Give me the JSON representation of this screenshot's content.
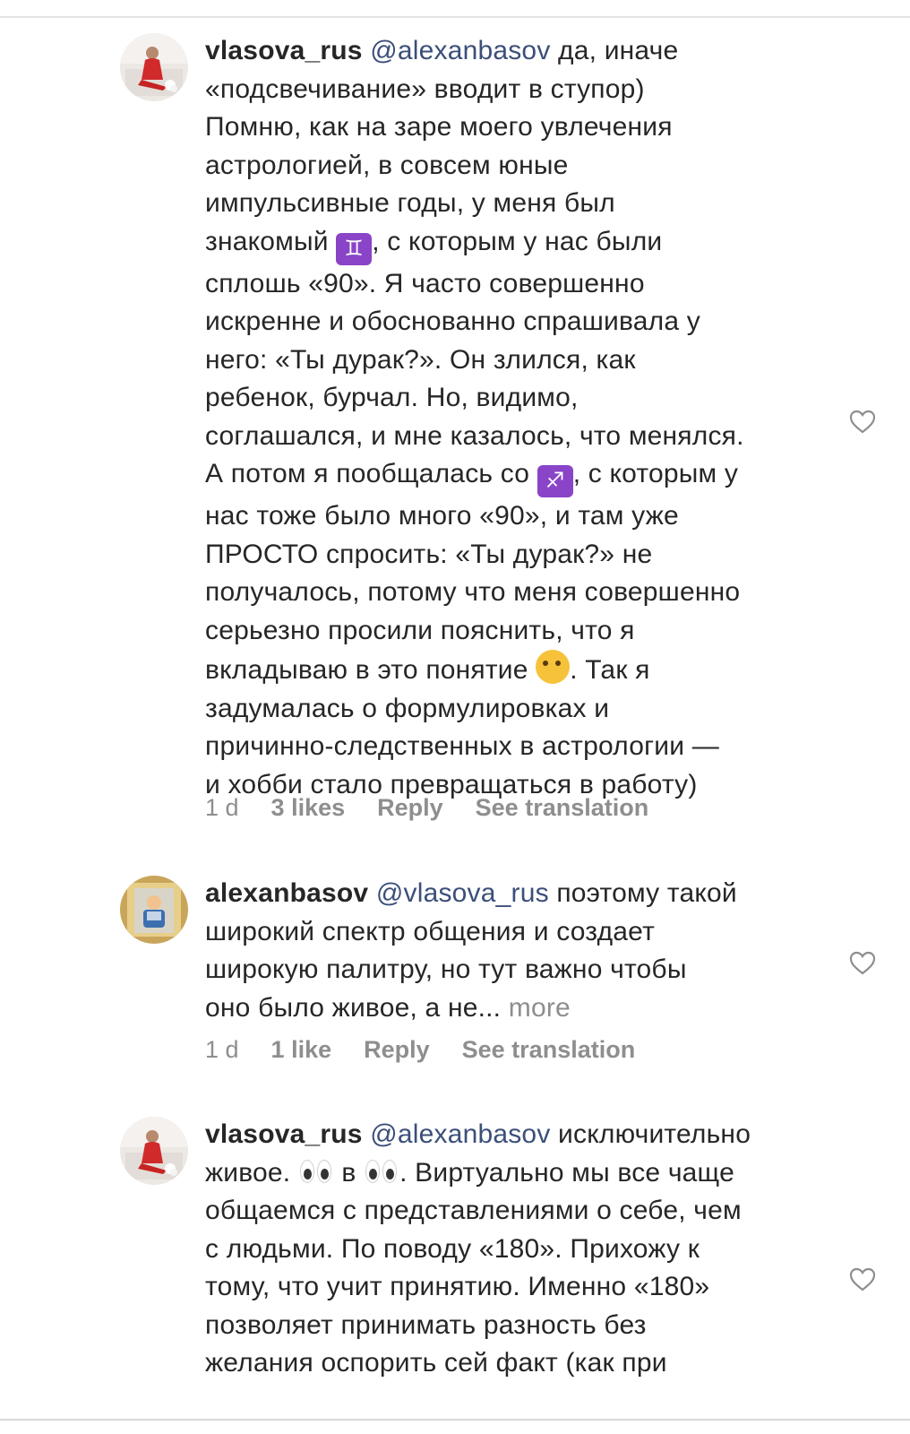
{
  "comments": [
    {
      "username": "vlasova_rus",
      "mention": "@alexanbasov",
      "text_1": " да, иначе\n«подсвечивание» вводит в ступор)\nПомню, как на заре моего увлечения\nастрологией, в совсем юные\nимпульсивные годы, у меня был\nзнакомый ",
      "text_2": ", с которым у нас были\nсплошь «90». Я часто совершенно\nискренне и обоснованно спрашивала у\nнего: «Ты дурак?». Он злился, как\nребенок, бурчал. Но, видимо,\nсоглашался, и мне казалось, что менялся.\nА потом я пообщалась со ",
      "text_3": ", с которым у\nнас тоже было много «90», и там уже\nПРОСТО спросить: «Ты дурак?» не\nполучалось, потому что меня совершенно\nсерьезно просили пояснить, что я\nвкладываю в это понятие ",
      "text_4": ". Так я\nзадумалась о формулировках и\nпричинно-следственных в астрологии —\nи хобби стало превращаться в работу)",
      "emoji_1": "♊",
      "emoji_2": "♐",
      "time": "1 d",
      "likes": "3 likes",
      "reply": "Reply",
      "translate": "See translation"
    },
    {
      "username": "alexanbasov",
      "mention": "@vlasova_rus",
      "text_1": " поэтому такой\nширокий спектр общения и создает\nширокую палитру, но тут важно чтобы\nоно было живое, а не... ",
      "more": "more",
      "time": "1 d",
      "likes": "1 like",
      "reply": "Reply",
      "translate": "See translation"
    },
    {
      "username": "vlasova_rus",
      "mention": "@alexanbasov",
      "text_1": " исключительно\nживое. ",
      "text_2": " в ",
      "text_3": ". Виртуально мы все чаще\nобщаемся с представлениями о себе, чем\nс людьми. По поводу «180». Прихожу к\nтому, что учит принятию. Именно «180»\nпозволяет принимать разность без\nжелания оспорить сей факт (как при"
    }
  ],
  "icons": {
    "like": "heart-outline-icon",
    "eyes": "eyes-emoji",
    "thinking": "thinking-face-emoji"
  },
  "colors": {
    "text": "#262626",
    "mention": "#3b4f7a",
    "meta": "#8e8e8e",
    "zodiac_emoji_bg": "#8a44c7"
  }
}
